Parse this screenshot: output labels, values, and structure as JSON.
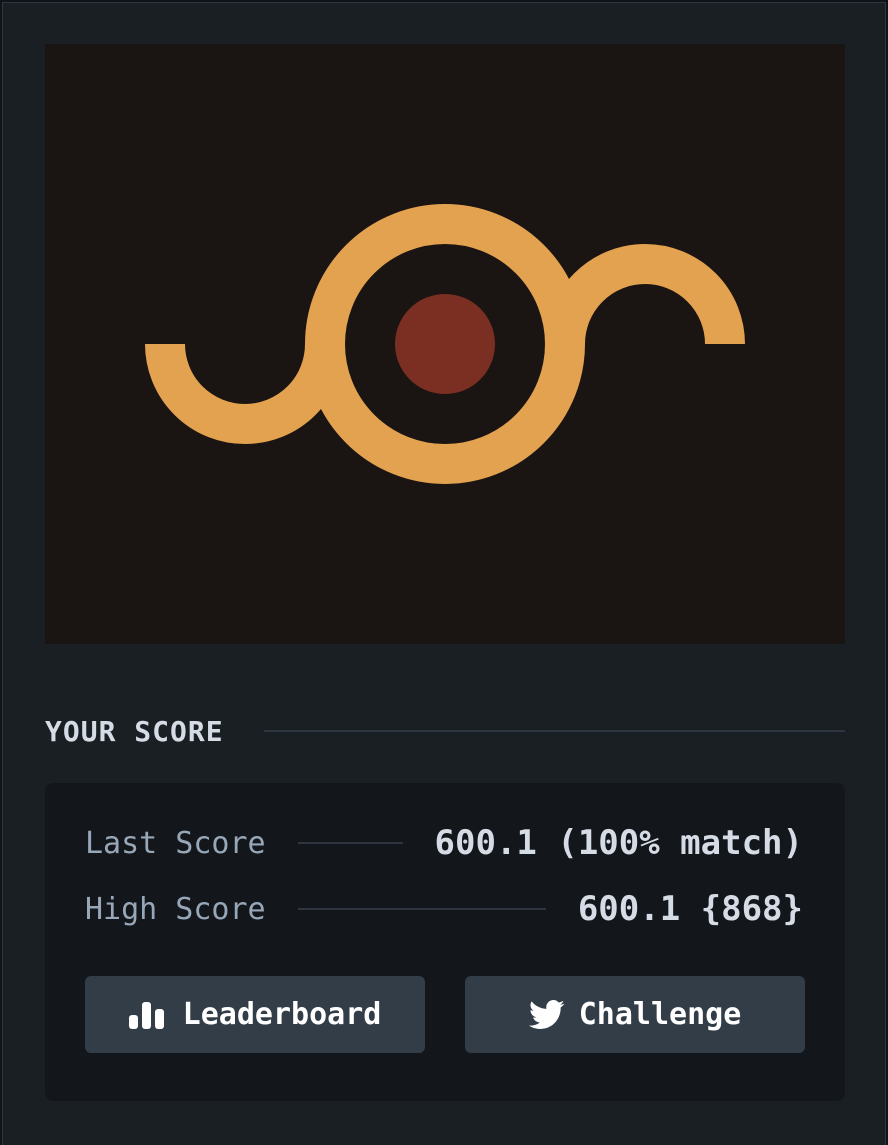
{
  "colors": {
    "panel_bg": "#1a1f24",
    "canvas_bg": "#1a1412",
    "shape_orange": "#e3a24f",
    "dot_red": "#7a2f22",
    "text_primary": "#d5dce6",
    "text_muted": "#97a7b8",
    "button_bg": "#323d48"
  },
  "score_section": {
    "title": "YOUR SCORE",
    "last_score_label": "Last Score",
    "last_score_value": "600.1 (100% match)",
    "high_score_label": "High Score",
    "high_score_value": "600.1 {868}"
  },
  "buttons": {
    "leaderboard_label": "Leaderboard",
    "leaderboard_icon": "bar-chart-icon",
    "challenge_label": "Challenge",
    "challenge_icon": "twitter-bird-icon"
  }
}
